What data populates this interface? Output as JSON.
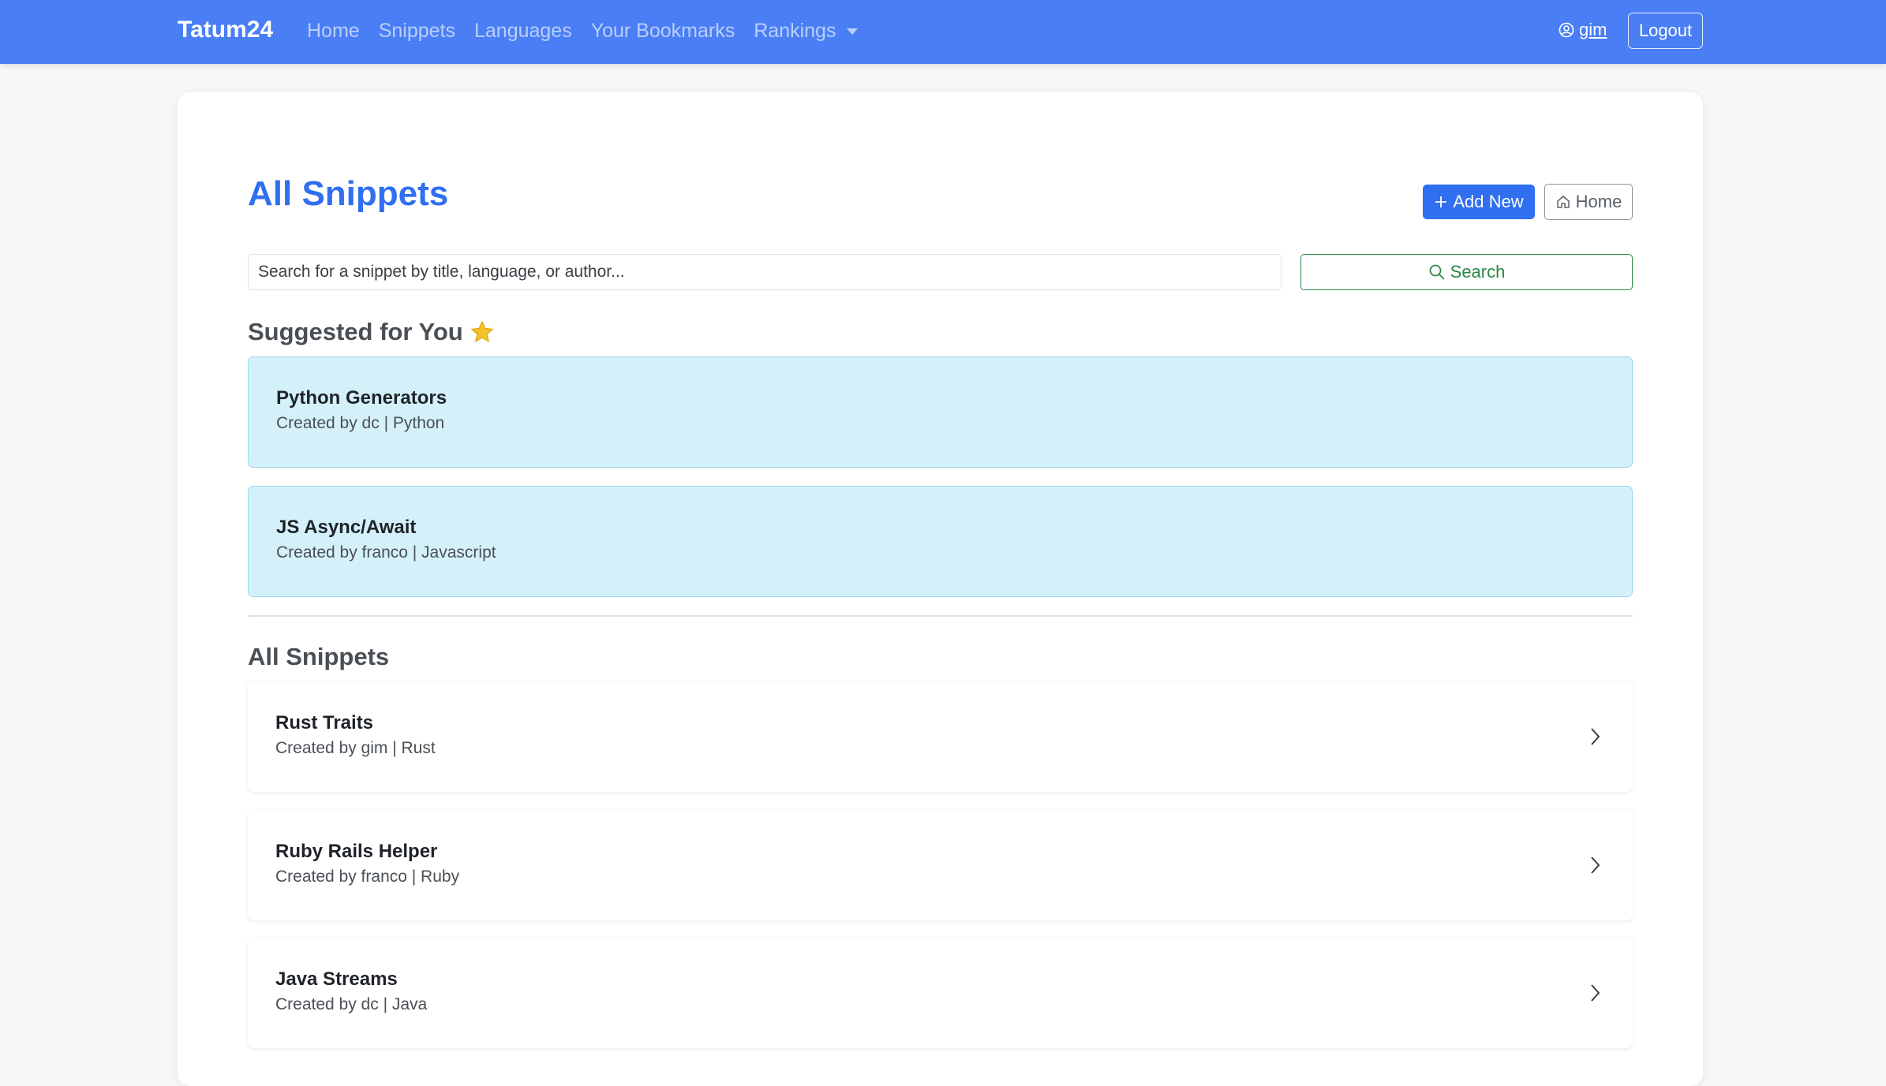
{
  "nav": {
    "brand": "Tatum24",
    "links": [
      {
        "label": "Home"
      },
      {
        "label": "Snippets"
      },
      {
        "label": "Languages"
      },
      {
        "label": "Your Bookmarks"
      },
      {
        "label": "Rankings"
      }
    ],
    "user": "gim",
    "logout": "Logout",
    "accent": "#4a7ef5"
  },
  "page": {
    "title": "All Snippets",
    "add_new": "Add New",
    "home": "Home",
    "search_placeholder": "Search for a snippet by title, language, or author...",
    "search_button": "Search"
  },
  "suggested": {
    "heading": "Suggested for You",
    "items": [
      {
        "title": "Python Generators",
        "meta": "Created by dc | Python"
      },
      {
        "title": "JS Async/Await",
        "meta": "Created by franco | Javascript"
      }
    ]
  },
  "all": {
    "heading": "All Snippets",
    "items": [
      {
        "title": "Rust Traits",
        "meta": "Created by gim | Rust"
      },
      {
        "title": "Ruby Rails Helper",
        "meta": "Created by franco | Ruby"
      },
      {
        "title": "Java Streams",
        "meta": "Created by dc | Java"
      }
    ]
  },
  "colors": {
    "primary": "#2f6ff0",
    "success": "#2a8748",
    "suggest_bg": "#d4f1f9",
    "star": "#f5c02b"
  }
}
